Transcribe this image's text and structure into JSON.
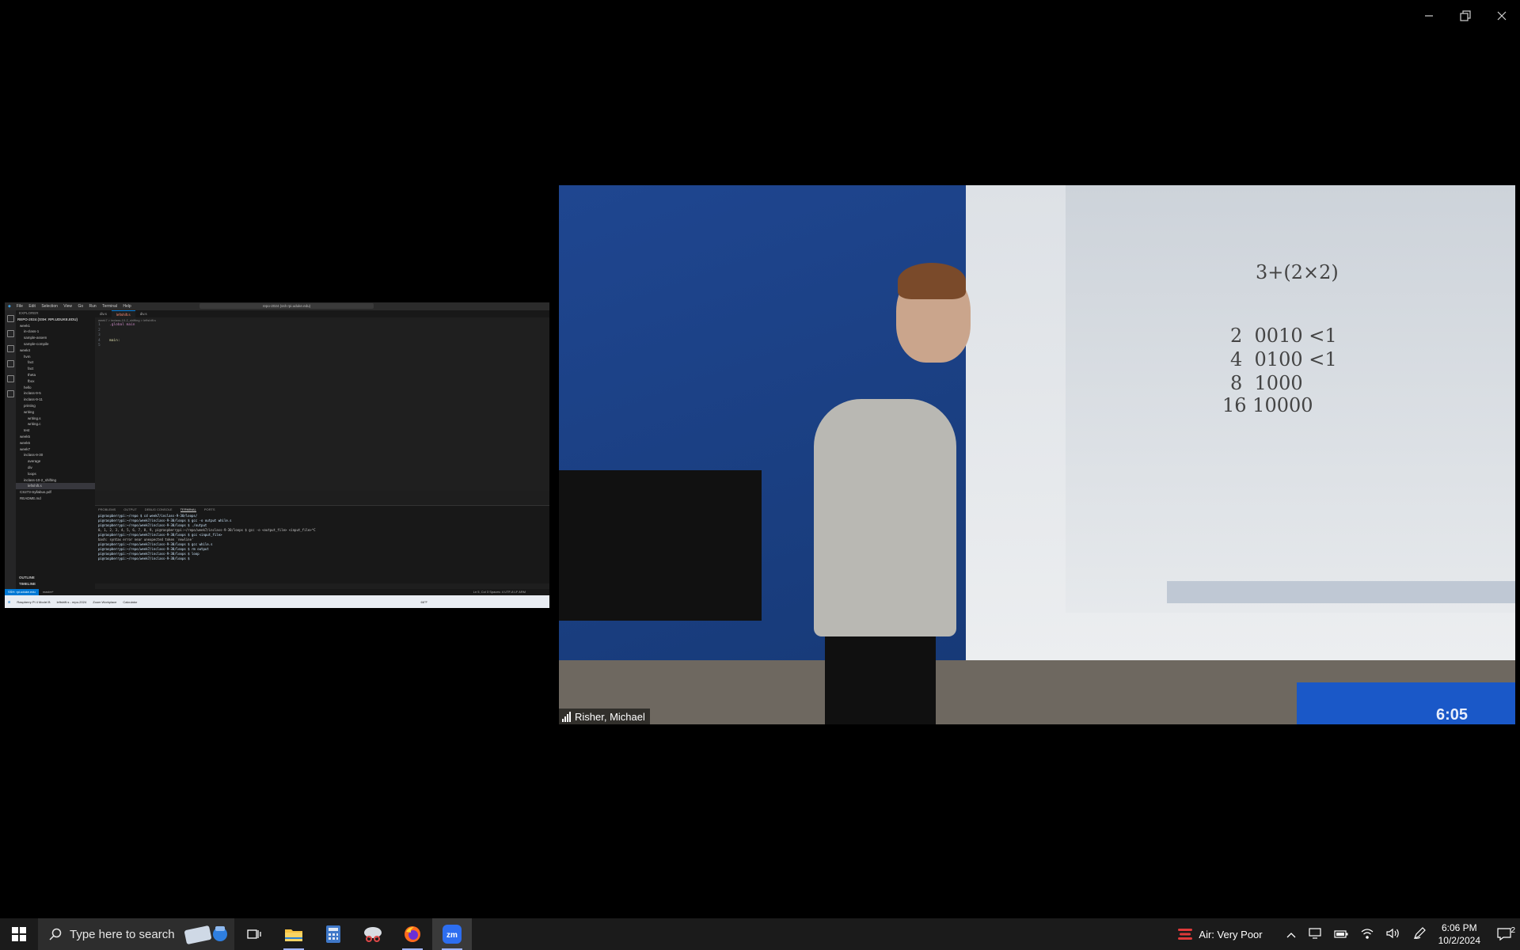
{
  "window": {
    "controls": [
      "minimize",
      "restore",
      "close"
    ]
  },
  "shared_screen": {
    "menu": [
      "File",
      "Edit",
      "Selection",
      "View",
      "Go",
      "Run",
      "Terminal",
      "Help"
    ],
    "command_center": "repo-2024 (ssh rpi.uduke.edu)",
    "explorer_title": "EXPLORER",
    "workspace": "REPO-2024 (SSH: RPI.UDUKE.EDU)",
    "tree": [
      "week1",
      "in-class-1",
      "sample-assem",
      "sample-compile",
      "week4",
      "hvm",
      "fact",
      "fact",
      "theta",
      "fbox",
      "hello",
      "inclass-9-5",
      "inclass-9-11",
      "printing",
      "writing",
      "writing.s",
      "writing.c",
      "test",
      "week5",
      "week6",
      "week7",
      "inclass-9-30",
      "average",
      "div",
      "loops",
      "inclass-10-2_shifting",
      "leftshift.s",
      "CS273-Syllabus.pdf",
      "README.md"
    ],
    "outline": "OUTLINE",
    "timeline": "TIMELINE",
    "tabs": [
      "div.s",
      "leftshift.s",
      "div.s"
    ],
    "breadcrumb": "week7 > inclass-10-2_shifting > leftshift.s",
    "code": [
      ".global main",
      "",
      "",
      "main:",
      ""
    ],
    "terminal_tabs": [
      "PROBLEMS",
      "OUTPUT",
      "DEBUG CONSOLE",
      "TERMINAL",
      "PORTS"
    ],
    "terminal_lines": [
      "pi@raspberrypi:~/repo $ cd week7/inclass-9-30/loops/",
      "pi@raspberrypi:~/repo/week7/inclass-9-30/loops $ gcc -o output while.s",
      "pi@raspberrypi:~/repo/week7/inclass-9-30/loops $ ./output",
      "0, 1, 2, 3, 4, 5, 6, 7, 8, 9, pi@raspberrypi:~/repo/week7/inclass-9-30/loops $ gcc -o <output_file> <input_file>^C",
      "pi@raspberrypi:~/repo/week7/inclass-9-30/loops $ gcc <input_file>",
      "bash: syntax error near unexpected token `newline'",
      "pi@raspberrypi:~/repo/week7/inclass-9-30/loops $ gcc while.s",
      "pi@raspberrypi:~/repo/week7/inclass-9-30/loops $ rm output",
      "pi@raspberrypi:~/repo/week7/inclass-9-30/loops $ loop",
      "pi@raspberrypi:~/repo/week7/inclass-9-30/loops $ "
    ],
    "status_remote": "SSH: rpi.uduke.edu",
    "status_branch": "master*",
    "status_right": "Ln 5, Col 3   Spaces: 4   UTF-8   LF   ARM",
    "inner_taskbar": [
      "Raspberry Pi 4 Model B",
      "leftshift.s - repo-2024",
      "Zoom Workplace",
      "Calculator"
    ],
    "inner_weather": "66°F"
  },
  "video": {
    "participant_name": "Risher, Michael",
    "whiteboard_expression": "3+(2×2)",
    "whiteboard_rows": [
      "2  0010 <1",
      "4  0100 <1",
      "8  1000",
      "16 10000"
    ],
    "clock_display": "6:05"
  },
  "taskbar": {
    "search_placeholder": "Type here to search",
    "pinned": [
      "task-view",
      "file-explorer",
      "calculator",
      "snipping-tool",
      "firefox",
      "zoom"
    ],
    "air_quality": "Air: Very Poor",
    "time": "6:06 PM",
    "date": "10/2/2024",
    "notification_count": "2"
  }
}
